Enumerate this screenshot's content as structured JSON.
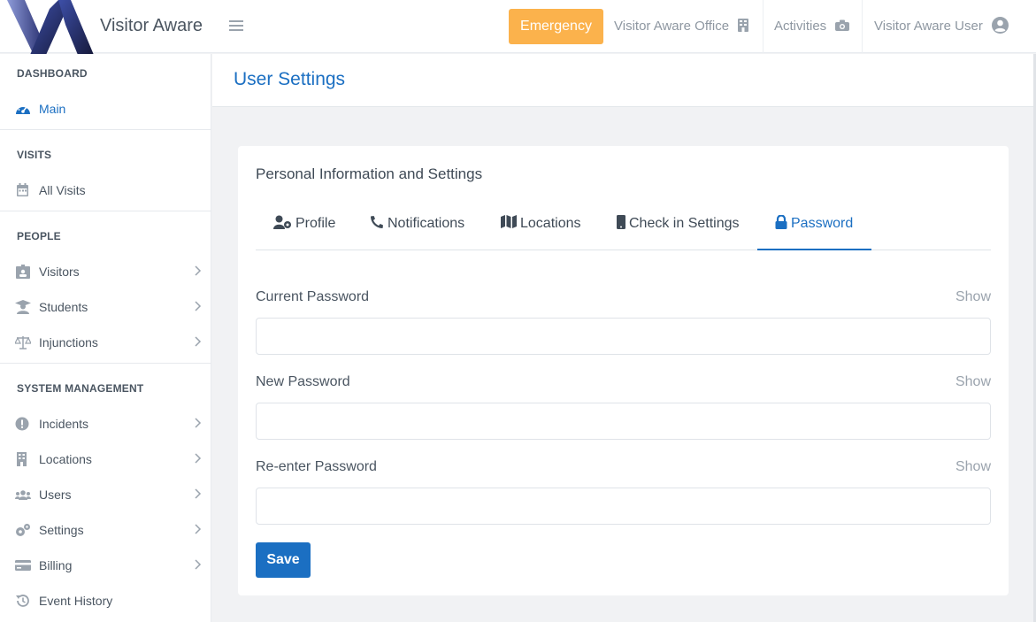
{
  "brand": {
    "name": "Visitor Aware"
  },
  "topbar": {
    "emergency_label": "Emergency",
    "office_label": "Visitor Aware Office",
    "activities_label": "Activities",
    "user_label": "Visitor Aware User"
  },
  "sidebar": {
    "sections": [
      {
        "title": "DASHBOARD",
        "items": [
          {
            "label": "Main",
            "icon": "dashboard-icon",
            "active": true
          }
        ]
      },
      {
        "title": "VISITS",
        "items": [
          {
            "label": "All Visits",
            "icon": "calendar-icon"
          }
        ]
      },
      {
        "title": "PEOPLE",
        "items": [
          {
            "label": "Visitors",
            "icon": "id-badge-icon",
            "chevron": true
          },
          {
            "label": "Students",
            "icon": "graduate-icon",
            "chevron": true
          },
          {
            "label": "Injunctions",
            "icon": "balance-scale-icon",
            "chevron": true
          }
        ]
      },
      {
        "title": "SYSTEM MANAGEMENT",
        "items": [
          {
            "label": "Incidents",
            "icon": "exclamation-icon",
            "chevron": true
          },
          {
            "label": "Locations",
            "icon": "building-icon",
            "chevron": true
          },
          {
            "label": "Users",
            "icon": "users-icon",
            "chevron": true
          },
          {
            "label": "Settings",
            "icon": "cogs-icon",
            "chevron": true
          },
          {
            "label": "Billing",
            "icon": "credit-card-icon",
            "chevron": true
          },
          {
            "label": "Event History",
            "icon": "history-icon"
          }
        ]
      }
    ]
  },
  "page": {
    "title": "User Settings"
  },
  "card": {
    "title": "Personal Information and Settings",
    "tabs": [
      {
        "label": "Profile",
        "icon": "user-cog-icon"
      },
      {
        "label": "Notifications",
        "icon": "phone-icon"
      },
      {
        "label": "Locations",
        "icon": "map-icon"
      },
      {
        "label": "Check in Settings",
        "icon": "tablet-icon"
      },
      {
        "label": "Password",
        "icon": "lock-icon",
        "active": true
      }
    ],
    "fields": [
      {
        "label": "Current Password",
        "show_label": "Show",
        "value": ""
      },
      {
        "label": "New Password",
        "show_label": "Show",
        "value": ""
      },
      {
        "label": "Re-enter Password",
        "show_label": "Show",
        "value": ""
      }
    ],
    "save_label": "Save"
  },
  "colors": {
    "accent": "#1b6fc2",
    "emergency": "#fbb24c"
  }
}
